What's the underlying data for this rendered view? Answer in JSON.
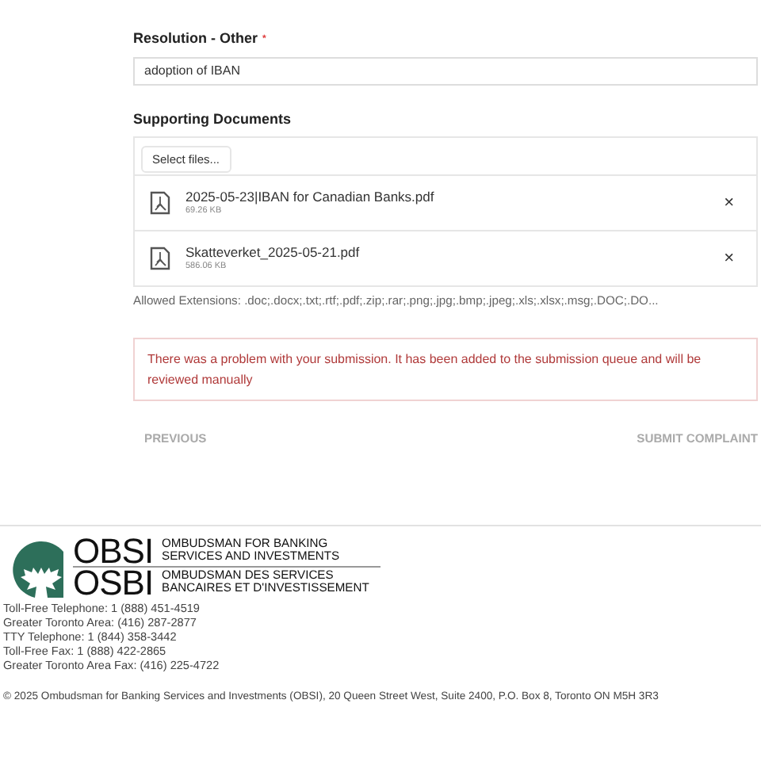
{
  "resolution": {
    "label": "Resolution - Other",
    "required_mark": "*",
    "value": "adoption of IBAN"
  },
  "documents": {
    "label": "Supporting Documents",
    "select_button": "Select files...",
    "files": [
      {
        "name": "2025-05-23|IBAN for Canadian Banks.pdf",
        "size": "69.26 KB",
        "remove": "×"
      },
      {
        "name": "Skatteverket_2025-05-21.pdf",
        "size": "586.06 KB",
        "remove": "×"
      }
    ],
    "allowed": "Allowed Extensions: .doc;.docx;.txt;.rtf;.pdf;.zip;.rar;.png;.jpg;.bmp;.jpeg;.xls;.xlsx;.msg;.DOC;.DO..."
  },
  "error": "There was a problem with your submission. It has been added to the submission queue and will be reviewed manually",
  "buttons": {
    "previous": "PREVIOUS",
    "submit": "SUBMIT COMPLAINT"
  },
  "footer": {
    "logo": {
      "acronym_en": "OBSI",
      "name_en": [
        "OMBUDSMAN FOR BANKING",
        "SERVICES AND INVESTMENTS"
      ],
      "acronym_fr": "OSBI",
      "name_fr": [
        "OMBUDSMAN DES SERVICES",
        "BANCAIRES ET D'INVESTISSEMENT"
      ]
    },
    "contacts": [
      "Toll-Free Telephone: 1 (888) 451-4519",
      "Greater Toronto Area: (416) 287-2877",
      "TTY Telephone: 1 (844) 358-3442",
      "Toll-Free Fax: 1 (888) 422-2865",
      "Greater Toronto Area Fax: (416) 225-4722"
    ],
    "copyright": "© 2025 Ombudsman for Banking Services and Investments (OBSI), 20 Queen Street West, Suite 2400, P.O. Box 8, Toronto ON M5H 3R3"
  }
}
